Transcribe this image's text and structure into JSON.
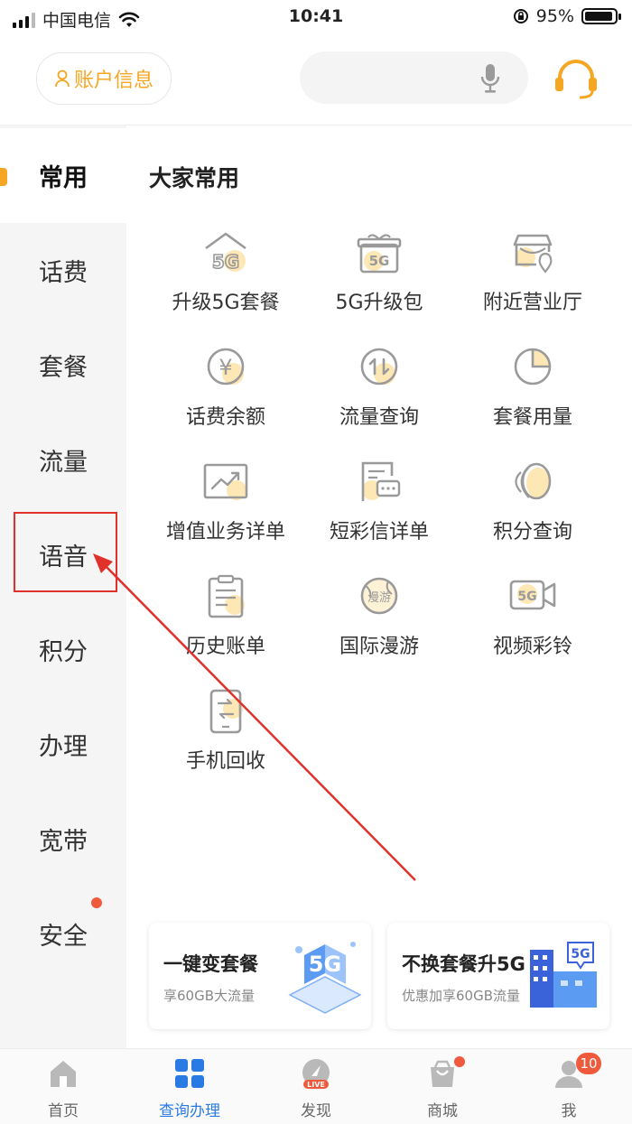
{
  "status_bar": {
    "carrier": "中国电信",
    "time": "10:41",
    "battery_percent": "95%",
    "battery_level": 0.95
  },
  "header": {
    "account_label": "账户信息",
    "icons": [
      "person-icon",
      "microphone-icon",
      "headset-icon"
    ]
  },
  "sidebar": {
    "items": [
      {
        "label": "常用",
        "active": true
      },
      {
        "label": "话费"
      },
      {
        "label": "套餐"
      },
      {
        "label": "流量"
      },
      {
        "label": "语音"
      },
      {
        "label": "积分"
      },
      {
        "label": "办理"
      },
      {
        "label": "宽带"
      },
      {
        "label": "安全",
        "dot": true
      }
    ]
  },
  "main": {
    "section_title": "大家常用",
    "items": [
      {
        "label": "升级5G套餐",
        "icon": "5g-home-icon",
        "icon_text": "5G"
      },
      {
        "label": "5G升级包",
        "icon": "5g-gift-icon",
        "icon_text": "5G"
      },
      {
        "label": "附近营业厅",
        "icon": "store-location-icon"
      },
      {
        "label": "话费余额",
        "icon": "yen-coin-icon",
        "icon_text": "¥"
      },
      {
        "label": "流量查询",
        "icon": "data-arrows-icon"
      },
      {
        "label": "套餐用量",
        "icon": "pie-chart-icon"
      },
      {
        "label": "增值业务详单",
        "icon": "trend-chart-icon"
      },
      {
        "label": "短彩信详单",
        "icon": "message-doc-icon"
      },
      {
        "label": "积分查询",
        "icon": "points-icon"
      },
      {
        "label": "历史账单",
        "icon": "clipboard-bill-icon"
      },
      {
        "label": "国际漫游",
        "icon": "globe-roaming-icon",
        "icon_text": "漫游"
      },
      {
        "label": "视频彩铃",
        "icon": "video-camera-icon",
        "icon_text": "5G"
      },
      {
        "label": "手机回收",
        "icon": "phone-recycle-icon"
      }
    ]
  },
  "promos": [
    {
      "title": "一键变套餐",
      "subtitle": "享60GB大流量",
      "image_text": "5G"
    },
    {
      "title": "不换套餐升5G",
      "subtitle": "优惠加享60GB流量",
      "image_text": "5G"
    }
  ],
  "tabbar": {
    "tabs": [
      {
        "label": "首页",
        "icon": "home-icon"
      },
      {
        "label": "查询办理",
        "icon": "grid-icon",
        "active": true
      },
      {
        "label": "发现",
        "icon": "discover-live-icon",
        "icon_text": "LIVE"
      },
      {
        "label": "商城",
        "icon": "shopping-bag-icon",
        "dot": true
      },
      {
        "label": "我",
        "icon": "profile-icon",
        "badge": "10"
      }
    ]
  },
  "colors": {
    "accent": "#f5a623",
    "active_tab": "#2a7ae4",
    "badge": "#f05a3c",
    "annotation": "#e0312b",
    "sidebar_bg": "#f5f5f5"
  }
}
